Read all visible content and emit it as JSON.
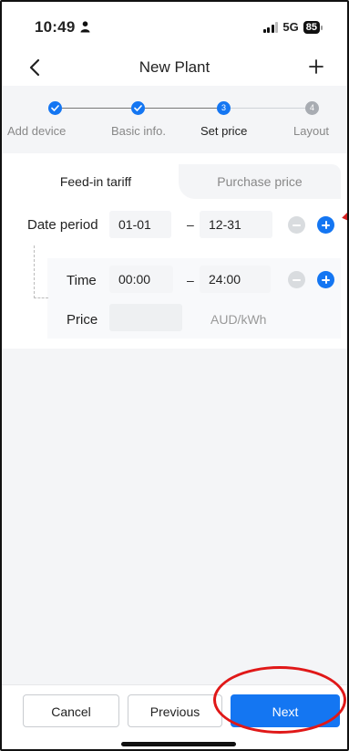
{
  "status_bar": {
    "time": "10:49",
    "network": "5G",
    "battery": "85"
  },
  "nav": {
    "title": "New Plant"
  },
  "stepper": {
    "steps": [
      {
        "label": "Add device",
        "state": "done",
        "number": ""
      },
      {
        "label": "Basic info.",
        "state": "done",
        "number": ""
      },
      {
        "label": "Set price",
        "state": "active",
        "number": "3"
      },
      {
        "label": "Layout",
        "state": "todo",
        "number": "4"
      }
    ]
  },
  "tabs": {
    "active": "Feed-in tariff",
    "inactive": "Purchase price"
  },
  "date_period": {
    "label": "Date period",
    "start": "01-01",
    "separator": "–",
    "end": "12-31"
  },
  "time_row": {
    "label": "Time",
    "start": "00:00",
    "separator": "–",
    "end": "24:00"
  },
  "price_row": {
    "label": "Price",
    "value": "",
    "unit": "AUD/kWh"
  },
  "footer": {
    "cancel": "Cancel",
    "previous": "Previous",
    "next": "Next"
  },
  "colors": {
    "accent": "#1476f2",
    "annotation": "#e01818",
    "background": "#f4f5f7"
  }
}
